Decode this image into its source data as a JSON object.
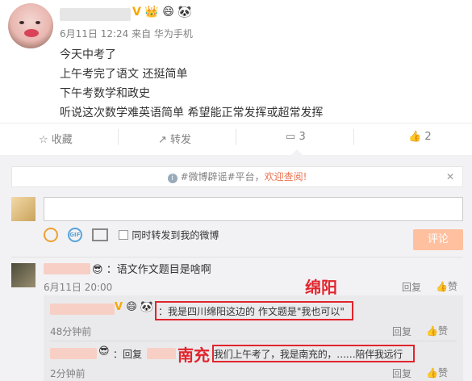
{
  "post": {
    "meta": "6月11日 12:24 来自 华为手机",
    "lines": [
      "今天中考了",
      "上午考完了语文 还挺简单",
      "下午考数学和政史",
      "听说这次数学难英语简单 希望能正常发挥或超常发挥"
    ],
    "badges": [
      "V",
      "👑",
      "😄",
      "🐼"
    ]
  },
  "actions": {
    "favorite": "收藏",
    "repost": "转发",
    "comments_count": "3",
    "likes_count": "2"
  },
  "notice": {
    "tag": "#微博辟谣#平台，",
    "link": "欢迎查阅!"
  },
  "composer": {
    "placeholder": "",
    "sync_label": "同时转发到我的微博",
    "submit": "评论"
  },
  "comments": [
    {
      "emoji": "😎",
      "text": "：语文作文题目是啥啊",
      "time": "6月11日 20:00",
      "reply": "回复",
      "like": "赞"
    }
  ],
  "replies": [
    {
      "badges": [
        "V",
        "😄",
        "🐼"
      ],
      "text": "：我是四川绵阳这边的 作文题是\"我也可以\"",
      "time": "48分钟前",
      "reply": "回复",
      "like": "赞"
    },
    {
      "prefix": "：回复",
      "emoji": "😎",
      "text": "我们上午考了，我是南充的，……陪伴我远行",
      "time": "2分钟前",
      "reply": "回复",
      "like": "赞"
    }
  ],
  "annotations": {
    "mianyang": "绵阳",
    "nanchong": "南充"
  },
  "colors": {
    "link": "#eb7350",
    "highlight": "#e1242c",
    "submit_bg": "#ffc09f"
  }
}
